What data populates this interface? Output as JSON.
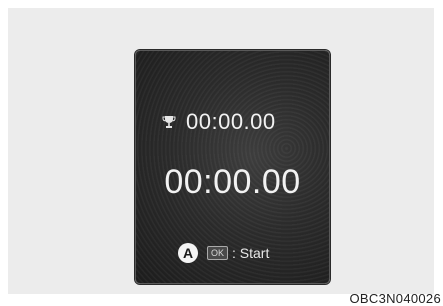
{
  "display": {
    "best_time": "00:00.00",
    "current_time": "00:00.00",
    "marker_label": "A",
    "ok_key_label": "OK",
    "hint_text": ": Start"
  },
  "icons": {
    "best_record": "trophy-icon"
  },
  "caption": "OBC3N040026"
}
